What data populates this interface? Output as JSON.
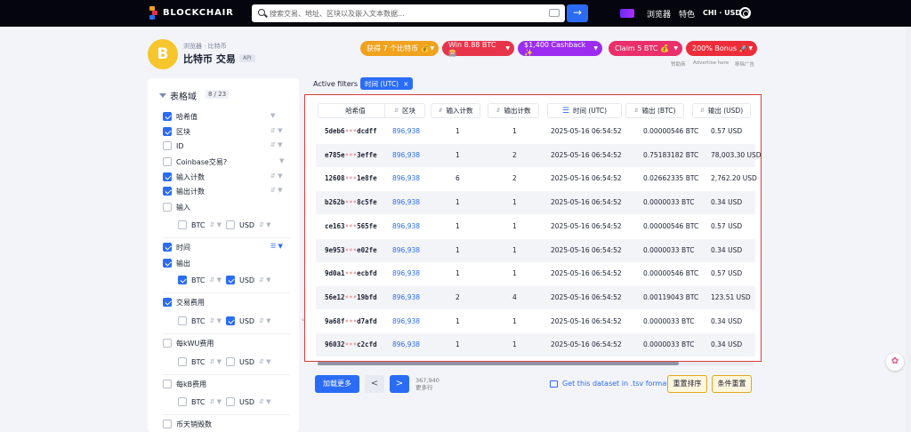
{
  "topbar": {
    "brand": "BLOCKCHAIR",
    "search_placeholder": "搜索交易、地址、区块以及嵌入文本数据...",
    "search_button": "→",
    "links": [
      "浏览器",
      "特色"
    ],
    "lang_currency": "CHI · USD"
  },
  "header": {
    "coin_symbol": "B",
    "breadcrumb": "浏览器 · 比特币",
    "title": "比特币 交易",
    "api_tag": "API",
    "coin_color": "#f7c52c"
  },
  "promos": [
    {
      "label": "获得 7 个比特币 💰",
      "color": "#f0a31e"
    },
    {
      "label": "Win 8.88 BTC 🎰",
      "color": "#e8344a"
    },
    {
      "label": "$1,400 Cashback ✨",
      "color": "#9b2cf0"
    },
    {
      "label": "Claim 5 BTC 💰",
      "color": "#ea2f6a"
    },
    {
      "label": "200% Bonus 🚀",
      "color": "#ee2d3a"
    }
  ],
  "promo_sub": {
    "left": "赞助商",
    "middle": "Advertise here",
    "right": "移除广告"
  },
  "sidebar": {
    "title": "表格域",
    "count": "8 / 23",
    "fields": [
      {
        "label": "哈希值",
        "checked": true
      },
      {
        "label": "区块",
        "checked": true
      },
      {
        "label": "ID",
        "checked": false
      },
      {
        "label": "Coinbase交易?",
        "checked": false
      },
      {
        "label": "输入计数",
        "checked": true
      },
      {
        "label": "输出计数",
        "checked": true
      },
      {
        "label": "输入",
        "checked": false
      },
      {
        "label": "时间",
        "checked": true
      },
      {
        "label": "输出",
        "checked": true
      },
      {
        "label": "交易费用",
        "checked": true
      },
      {
        "label": "每kWU费用",
        "checked": false
      },
      {
        "label": "每kB费用",
        "checked": false
      },
      {
        "label": "币天销毁数",
        "checked": false
      }
    ],
    "btc_label": "BTC",
    "usd_label": "USD"
  },
  "filters": {
    "label": "Active filters",
    "chip": "时间 (UTC)",
    "chip_close": "×"
  },
  "table": {
    "headers": [
      "哈希值",
      "区块",
      "输入计数",
      "输出计数",
      "时间 (UTC)",
      "输出 (BTC)",
      "输出 (USD)"
    ],
    "rows": [
      {
        "h1": "5deb6",
        "h2": "dcdff",
        "block": "896,938",
        "in": "1",
        "out": "1",
        "time": "2025-05-16 06:54:52",
        "btc": "0.00000546 BTC",
        "usd": "0.57 USD"
      },
      {
        "h1": "e785e",
        "h2": "3effe",
        "block": "896,938",
        "in": "1",
        "out": "2",
        "time": "2025-05-16 06:54:52",
        "btc": "0.75183182 BTC",
        "usd": "78,003.30 USD"
      },
      {
        "h1": "12608",
        "h2": "1e8fe",
        "block": "896,938",
        "in": "6",
        "out": "2",
        "time": "2025-05-16 06:54:52",
        "btc": "0.02662335 BTC",
        "usd": "2,762.20 USD"
      },
      {
        "h1": "b262b",
        "h2": "8c5fe",
        "block": "896,938",
        "in": "1",
        "out": "1",
        "time": "2025-05-16 06:54:52",
        "btc": "0.0000033 BTC",
        "usd": "0.34 USD"
      },
      {
        "h1": "ce163",
        "h2": "565fe",
        "block": "896,938",
        "in": "1",
        "out": "1",
        "time": "2025-05-16 06:54:52",
        "btc": "0.00000546 BTC",
        "usd": "0.57 USD"
      },
      {
        "h1": "9e953",
        "h2": "e02fe",
        "block": "896,938",
        "in": "1",
        "out": "1",
        "time": "2025-05-16 06:54:52",
        "btc": "0.0000033 BTC",
        "usd": "0.34 USD"
      },
      {
        "h1": "9d0a1",
        "h2": "ecbfd",
        "block": "896,938",
        "in": "1",
        "out": "1",
        "time": "2025-05-16 06:54:52",
        "btc": "0.00000546 BTC",
        "usd": "0.57 USD"
      },
      {
        "h1": "56e12",
        "h2": "19bfd",
        "block": "896,938",
        "in": "2",
        "out": "4",
        "time": "2025-05-16 06:54:52",
        "btc": "0.00119043 BTC",
        "usd": "123.51 USD"
      },
      {
        "h1": "9a68f",
        "h2": "d7afd",
        "block": "896,938",
        "in": "1",
        "out": "1",
        "time": "2025-05-16 06:54:52",
        "btc": "0.0000033 BTC",
        "usd": "0.34 USD"
      },
      {
        "h1": "96032",
        "h2": "c2cfd",
        "block": "896,938",
        "in": "1",
        "out": "1",
        "time": "2025-05-16 06:54:52",
        "btc": "0.0000033 BTC",
        "usd": "0.34 USD"
      }
    ],
    "hash_dots": "•••"
  },
  "pager": {
    "load_more": "加载更多",
    "prev": "<",
    "next": ">",
    "total": "367,940",
    "total_sub": "更多行",
    "tsv": "Get this dataset in .tsv format",
    "reset_sort": "重置排序",
    "reset_filter": "条件重置"
  },
  "colors": {
    "accent": "#2a6cf6",
    "highlight_border": "#e03b3b"
  }
}
